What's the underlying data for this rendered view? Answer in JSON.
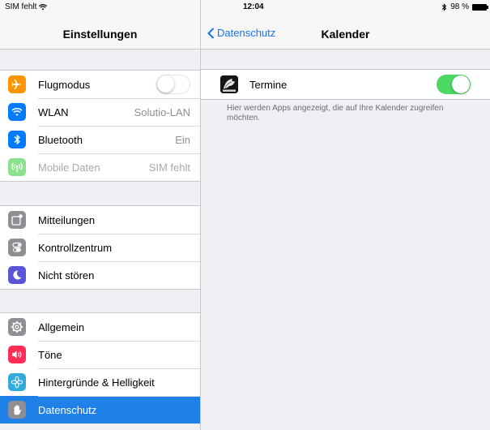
{
  "statusbar": {
    "carrier": "SIM fehlt",
    "time": "12:04",
    "battery": "98 %"
  },
  "left_pane": {
    "title": "Einstellungen",
    "groups": [
      [
        {
          "label": "Flugmodus",
          "value": "",
          "icon": "airplane-icon",
          "color": "#ff9500",
          "toggle": "off"
        },
        {
          "label": "WLAN",
          "value": "Solutio-LAN",
          "icon": "wifi-icon",
          "color": "#007aff"
        },
        {
          "label": "Bluetooth",
          "value": "Ein",
          "icon": "bluetooth-icon",
          "color": "#007aff"
        },
        {
          "label": "Mobile Daten",
          "value": "SIM fehlt",
          "icon": "antenna-icon",
          "color": "#8ce18c",
          "dimmed": true
        }
      ],
      [
        {
          "label": "Mitteilungen",
          "icon": "notifications-icon",
          "color": "#8e8e93"
        },
        {
          "label": "Kontrollzentrum",
          "icon": "control-center-icon",
          "color": "#8e8e93"
        },
        {
          "label": "Nicht stören",
          "icon": "moon-icon",
          "color": "#5856d6"
        }
      ],
      [
        {
          "label": "Allgemein",
          "icon": "gear-icon",
          "color": "#8e8e93"
        },
        {
          "label": "Töne",
          "icon": "speaker-icon",
          "color": "#ff2d55"
        },
        {
          "label": "Hintergründe & Helligkeit",
          "icon": "flower-icon",
          "color": "#34aadc"
        },
        {
          "label": "Datenschutz",
          "icon": "hand-icon",
          "color": "#8e8e93",
          "selected": true
        }
      ]
    ]
  },
  "right_pane": {
    "back_label": "Datenschutz",
    "title": "Kalender",
    "app_row": {
      "label": "Termine",
      "icon": "termine-app-icon",
      "toggle": "on"
    },
    "footer": "Hier werden Apps angezeigt, die auf Ihre Kalender zugreifen möchten."
  },
  "colors": {
    "accent": "#1a73e8",
    "selection": "#1f80e8",
    "toggle_on": "#4cd964"
  }
}
